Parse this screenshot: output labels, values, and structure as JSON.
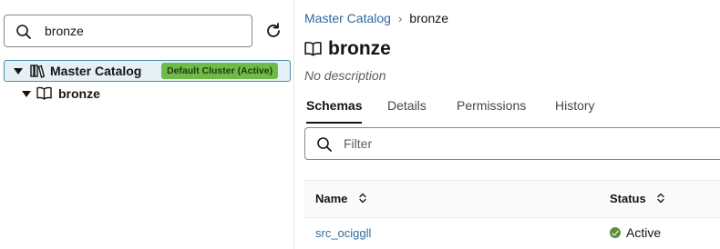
{
  "tree_search": {
    "value": "bronze",
    "icon": "search-icon"
  },
  "refresh": {
    "icon": "refresh-icon"
  },
  "tree": {
    "root": {
      "label": "Master Catalog",
      "badge": "Default Cluster (Active)",
      "icon": "library-icon",
      "expanded": true
    },
    "children": [
      {
        "label": "bronze",
        "icon": "book-icon",
        "expanded": true
      }
    ]
  },
  "breadcrumb": {
    "parent": "Master Catalog",
    "separator": "›",
    "current": "bronze"
  },
  "header": {
    "title": "bronze",
    "description": "No description",
    "icon": "book-icon"
  },
  "tabs": [
    {
      "label": "Schemas",
      "active": true
    },
    {
      "label": "Details",
      "active": false
    },
    {
      "label": "Permissions",
      "active": false
    },
    {
      "label": "History",
      "active": false
    }
  ],
  "filter": {
    "placeholder": "Filter"
  },
  "table": {
    "columns": [
      "Name",
      "Status"
    ],
    "rows": [
      {
        "name": "src_ocigg",
        "name_suffix": "ll",
        "status": "Active"
      }
    ]
  },
  "colors": {
    "link": "#2b6aa1",
    "badge": "#6fbb4a",
    "selection": "#e4f0f6",
    "status_active": "#5b8f3a"
  }
}
